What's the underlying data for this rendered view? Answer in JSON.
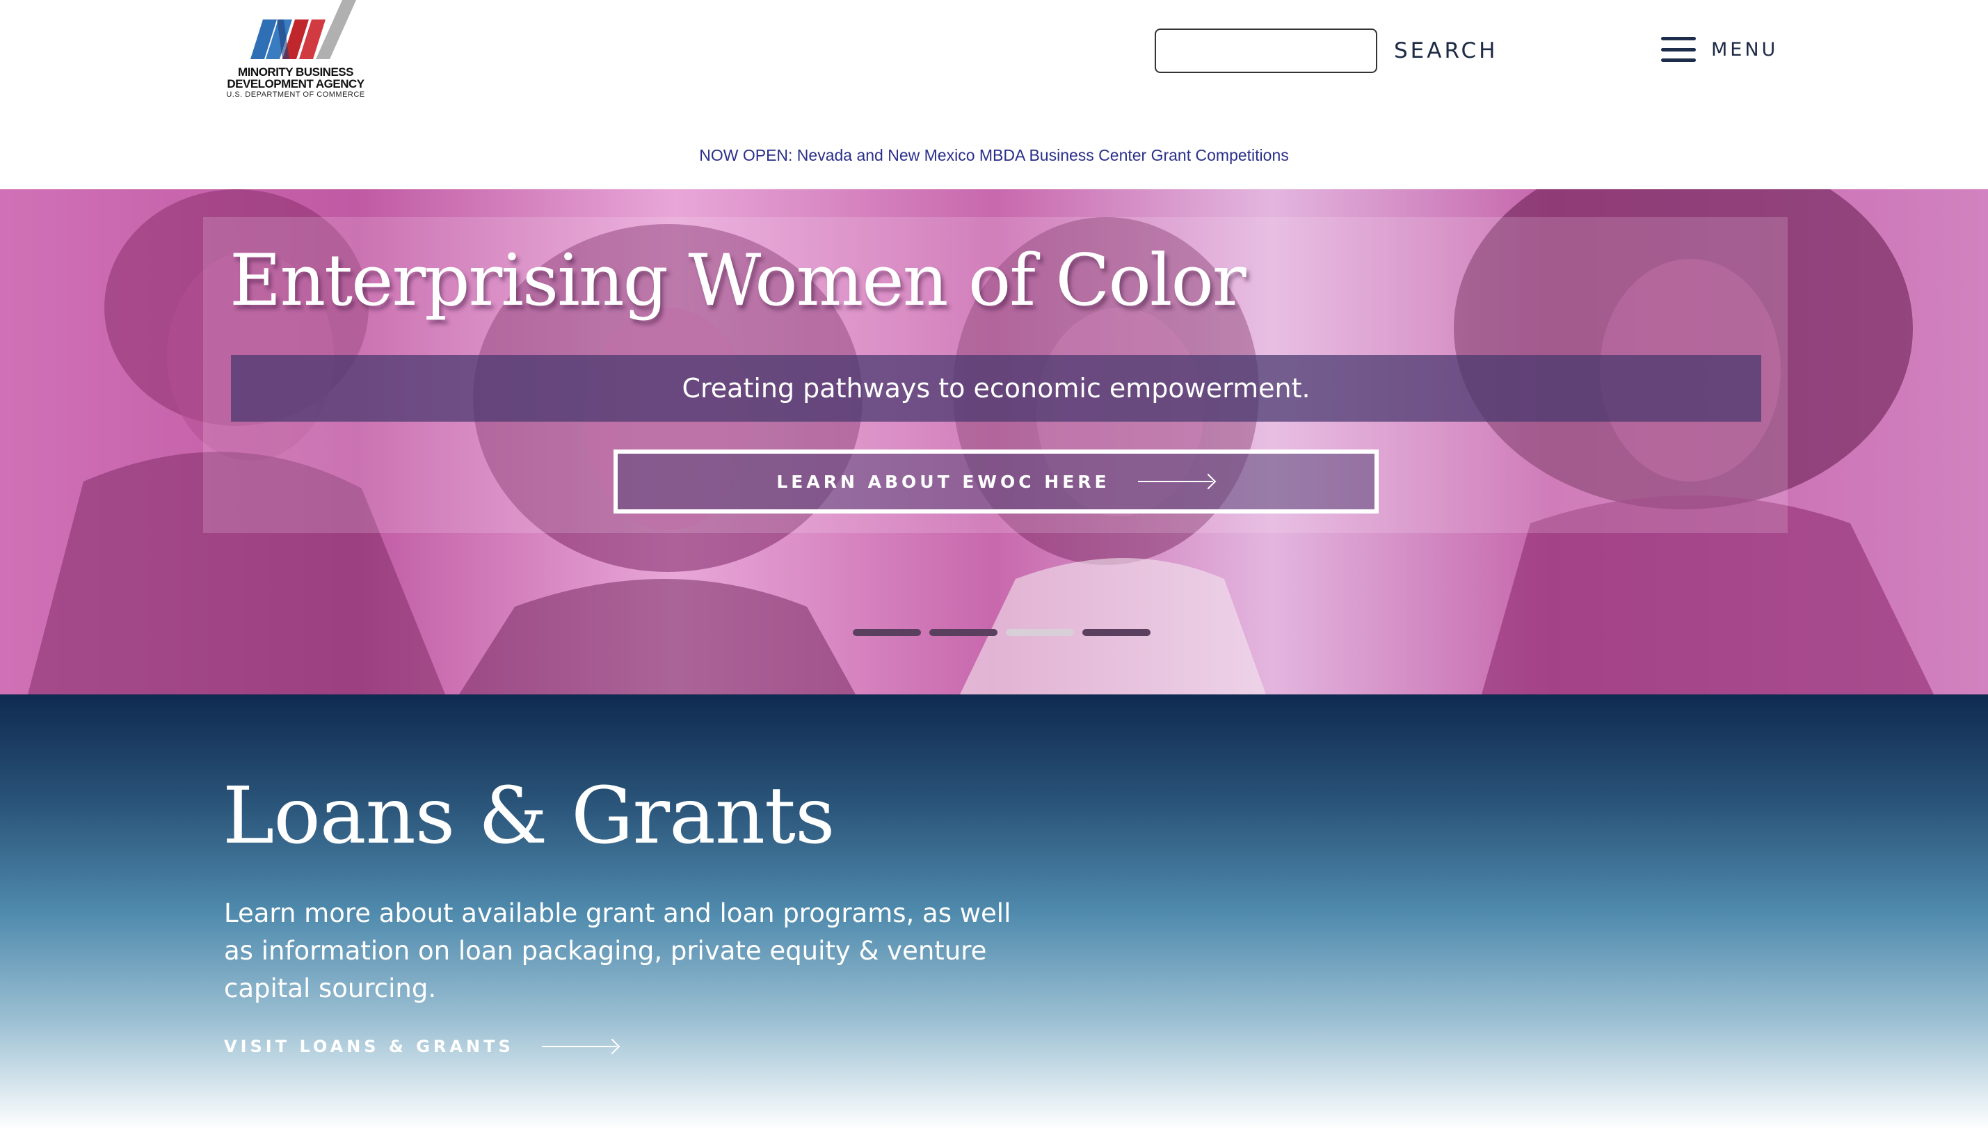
{
  "header": {
    "logo": {
      "line1": "MINORITY BUSINESS",
      "line2": "DEVELOPMENT AGENCY",
      "line3": "U.S. DEPARTMENT OF COMMERCE",
      "colors": {
        "blue": "#2f6fb5",
        "red": "#c0272d",
        "gray": "#9a9a9a"
      }
    },
    "search": {
      "value": "",
      "placeholder": "",
      "button_label": "SEARCH"
    },
    "menu": {
      "label": "MENU",
      "icon": "hamburger-icon"
    }
  },
  "announcement": {
    "text": "NOW OPEN: Nevada and New Mexico MBDA Business Center Grant Competitions",
    "color": "#2b2f8a"
  },
  "hero": {
    "title": "Enterprising Women of Color",
    "subtitle": "Creating pathways to economic empowerment.",
    "cta_label": "LEARN ABOUT EWOC HERE",
    "cta_icon": "arrow-right-icon",
    "slide_count": 4,
    "active_slide": 3,
    "tint_color": "#c0559f"
  },
  "loans": {
    "title": "Loans & Grants",
    "text": "Learn more about available grant and loan programs, as well as information on loan packaging, private equity & venture capital sourcing.",
    "link_label": "VISIT LOANS & GRANTS",
    "link_icon": "arrow-right-icon",
    "gradient_top": "#0f2a50",
    "gradient_bottom": "#ffffff"
  }
}
